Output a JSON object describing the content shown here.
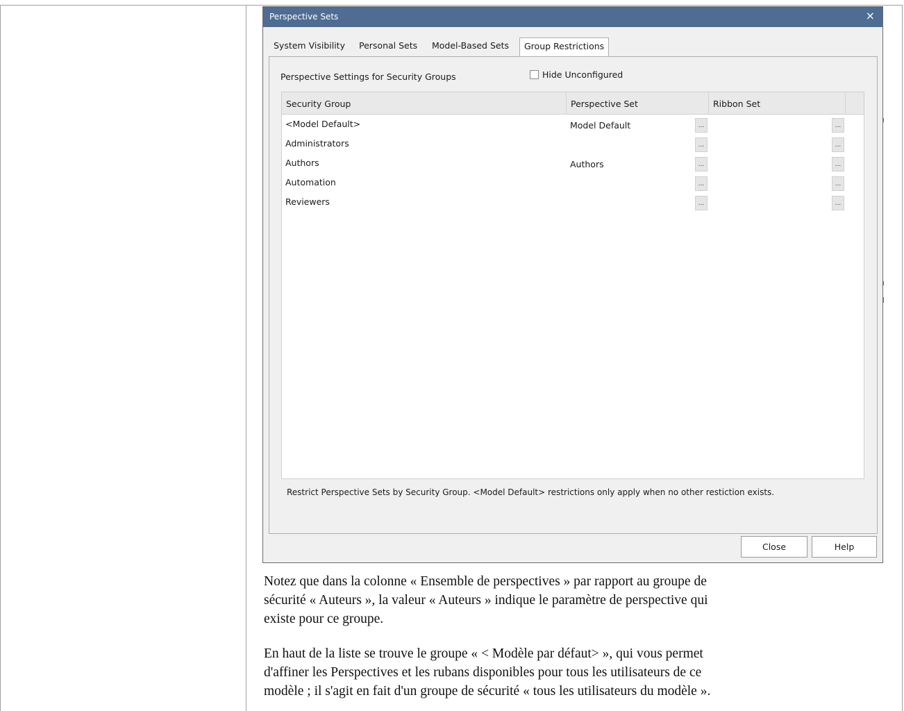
{
  "dialog": {
    "title": "Perspective Sets",
    "close_glyph": "×",
    "tabs": [
      "System Visibility",
      "Personal Sets",
      "Model-Based Sets",
      "Group Restrictions"
    ],
    "active_tab": "Group Restrictions",
    "section_label": "Perspective Settings for Security Groups",
    "hide_unconfigured": {
      "label": "Hide Unconfigured",
      "checked": false
    },
    "grid": {
      "columns": [
        "Security Group",
        "Perspective Set",
        "Ribbon Set"
      ],
      "ellipsis": "...",
      "rows": [
        {
          "group": "<Model Default>",
          "perspective_set": "Model Default",
          "ribbon_set": ""
        },
        {
          "group": "Administrators",
          "perspective_set": "",
          "ribbon_set": ""
        },
        {
          "group": "Authors",
          "perspective_set": "Authors",
          "ribbon_set": ""
        },
        {
          "group": "Automation",
          "perspective_set": "",
          "ribbon_set": ""
        },
        {
          "group": "Reviewers",
          "perspective_set": "",
          "ribbon_set": ""
        }
      ]
    },
    "hint": "Restrict Perspective Sets by Security Group. <Model Default> restrictions only apply when no other restiction exists.",
    "buttons": {
      "close": "Close",
      "help": "Help"
    }
  },
  "document": {
    "paragraph1": [
      "Notez que dans la colonne « Ensemble de perspectives » par rapport au groupe de",
      "sécurité « Auteurs », la valeur « Auteurs » indique le paramètre de perspective qui",
      "existe pour ce groupe."
    ],
    "paragraph2": [
      "En haut de la liste se trouve le groupe « < Modèle par défaut> », qui vous permet",
      "d'affiner les Perspectives et les rubans disponibles pour tous les utilisateurs de ce",
      "modèle ; il s'agit en fait d'un groupe de sécurité « tous les utilisateurs du modèle »."
    ]
  }
}
